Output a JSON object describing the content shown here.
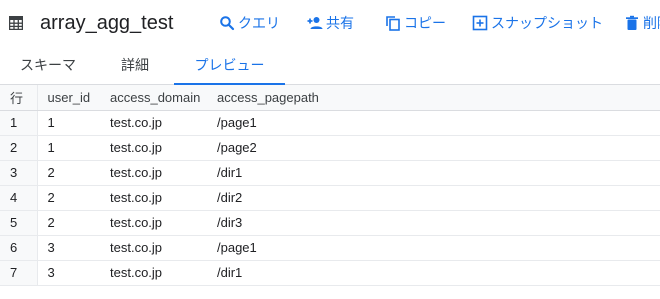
{
  "header": {
    "title": "array_agg_test",
    "actions": [
      {
        "label": "クエリ",
        "icon": "search-icon"
      },
      {
        "label": "共有",
        "icon": "person-add-icon"
      },
      {
        "label": "コピー",
        "icon": "copy-icon"
      },
      {
        "label": "スナップショット",
        "icon": "snapshot-icon"
      },
      {
        "label": "削除",
        "icon": "delete-icon"
      }
    ]
  },
  "tabs": [
    {
      "label": "スキーマ",
      "active": false
    },
    {
      "label": "詳細",
      "active": false
    },
    {
      "label": "プレビュー",
      "active": true
    }
  ],
  "table": {
    "columns": [
      "行",
      "user_id",
      "access_domain",
      "access_pagepath"
    ],
    "rows": [
      [
        "1",
        "1",
        "test.co.jp",
        "/page1"
      ],
      [
        "2",
        "1",
        "test.co.jp",
        "/page2"
      ],
      [
        "3",
        "2",
        "test.co.jp",
        "/dir1"
      ],
      [
        "4",
        "2",
        "test.co.jp",
        "/dir2"
      ],
      [
        "5",
        "2",
        "test.co.jp",
        "/dir3"
      ],
      [
        "6",
        "3",
        "test.co.jp",
        "/page1"
      ],
      [
        "7",
        "3",
        "test.co.jp",
        "/dir1"
      ]
    ]
  },
  "colors": {
    "accent": "#1a73e8",
    "text": "#202124",
    "border": "#dadce0",
    "header_bg": "#f8f9fa"
  }
}
